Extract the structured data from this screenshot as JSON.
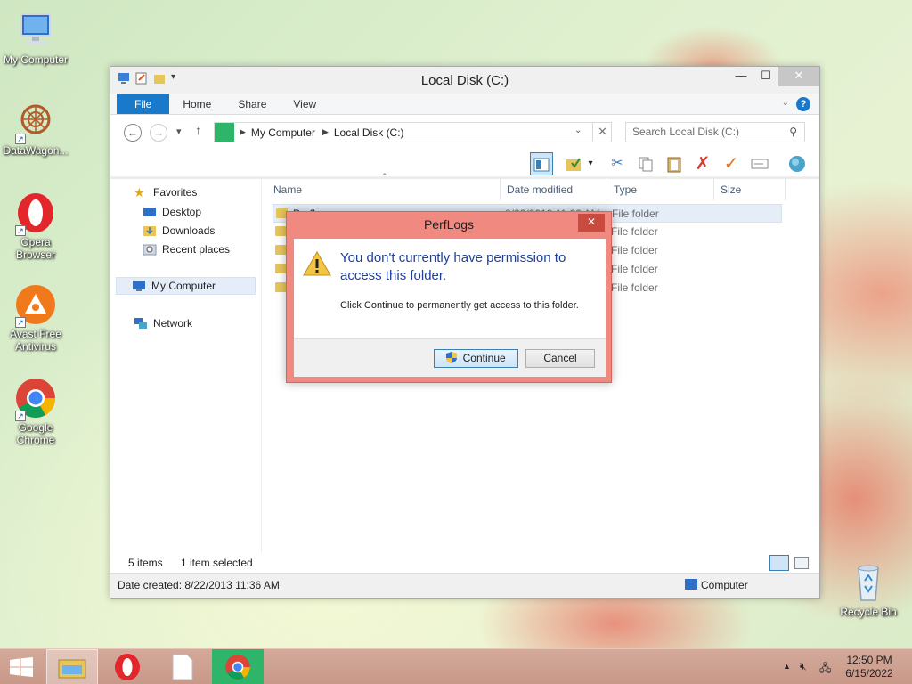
{
  "desktop": {
    "icons": [
      {
        "label": "My Computer"
      },
      {
        "label": "DataWagon..."
      },
      {
        "label": "Opera Browser"
      },
      {
        "label": "Avast Free Antivirus"
      },
      {
        "label": "Google Chrome"
      },
      {
        "label": "Recycle Bin"
      }
    ]
  },
  "window": {
    "title": "Local Disk (C:)",
    "close_glyph": "✕",
    "min_glyph": "—",
    "max_glyph": "☐",
    "ribbon_tabs": [
      "File",
      "Home",
      "Share",
      "View"
    ],
    "address": {
      "segments": [
        "My Computer",
        "Local Disk (C:)"
      ]
    },
    "search_placeholder": "Search Local Disk (C:)",
    "nav_pane": {
      "favorites": "Favorites",
      "desktop": "Desktop",
      "downloads": "Downloads",
      "recent": "Recent places",
      "my_computer": "My Computer",
      "network": "Network"
    },
    "columns": [
      "Name",
      "Date modified",
      "Type",
      "Size"
    ],
    "files": [
      {
        "name": "PerfLogs",
        "date": "8/22/2013 11:22 AM",
        "type": "File folder"
      },
      {
        "name": "",
        "date": "",
        "type": "File folder"
      },
      {
        "name": "",
        "date": "",
        "type": "File folder"
      },
      {
        "name": "",
        "date": "",
        "type": "File folder"
      },
      {
        "name": "",
        "date": "",
        "type": "File folder"
      }
    ],
    "status": {
      "items": "5 items",
      "selected": "1 item selected"
    },
    "details": {
      "date_created": "Date created: 8/22/2013 11:36 AM",
      "location": "Computer"
    }
  },
  "dialog": {
    "title": "PerfLogs",
    "main_text": "You don't currently have permission to access this folder.",
    "sub_text": "Click Continue to permanently get access to this folder.",
    "continue_label": "Continue",
    "cancel_label": "Cancel",
    "close_glyph": "✕"
  },
  "taskbar": {
    "time": "12:50 PM",
    "date": "6/15/2022"
  }
}
